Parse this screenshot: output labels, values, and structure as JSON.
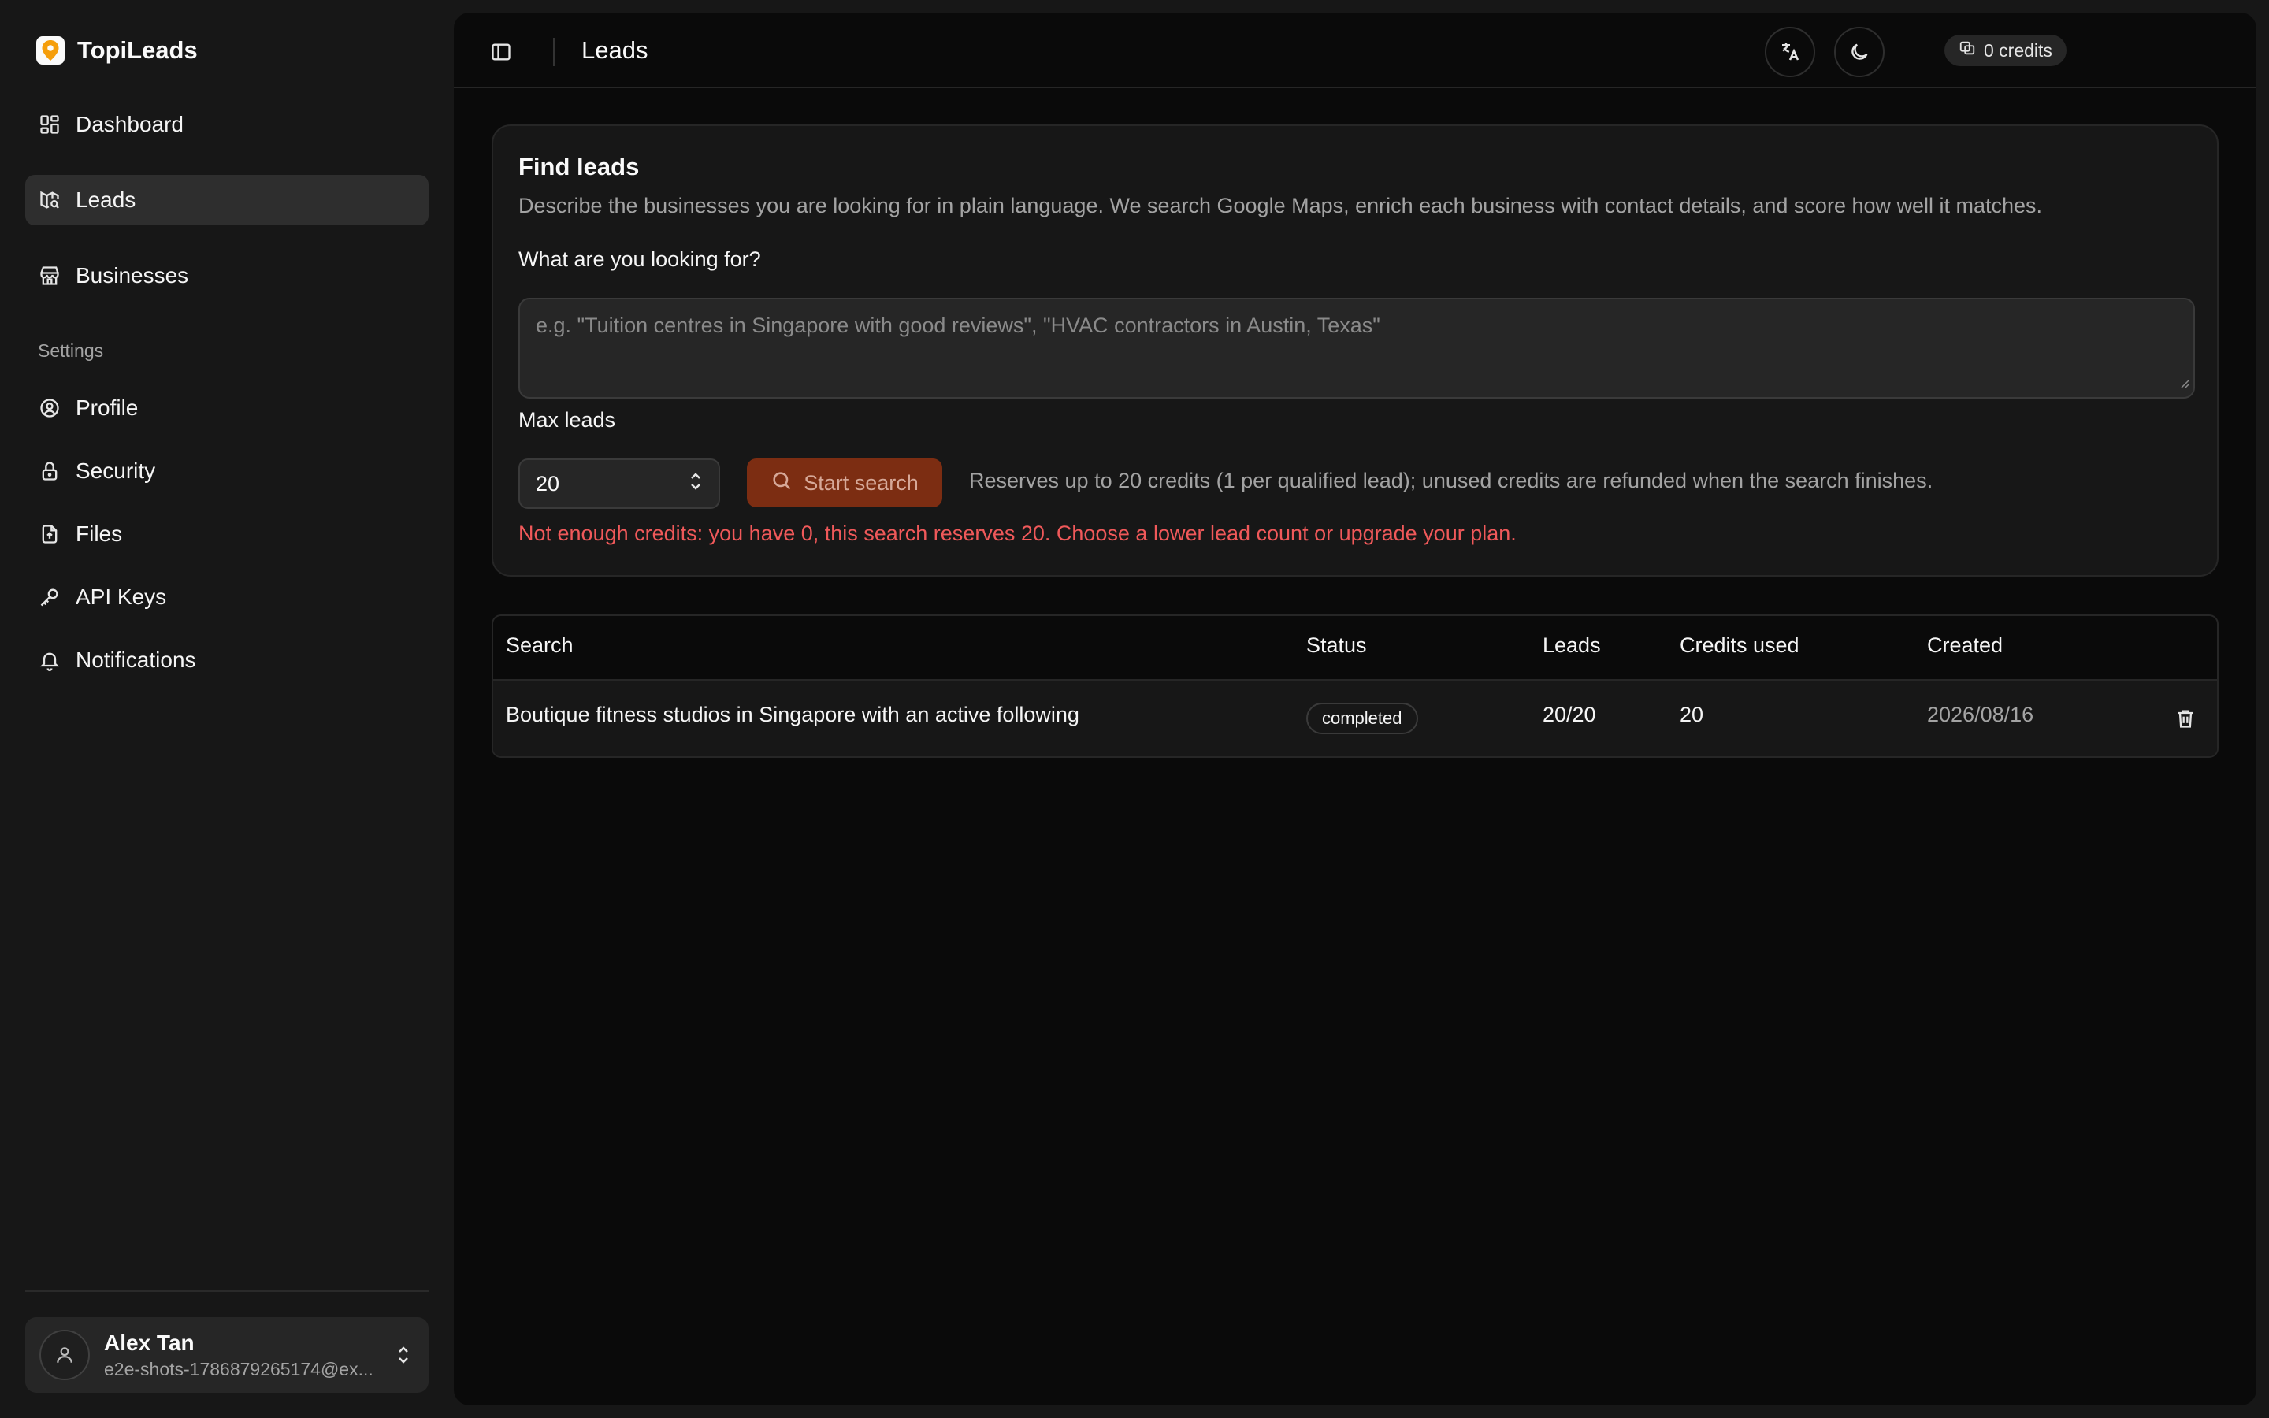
{
  "app": {
    "name": "TopiLeads"
  },
  "sidebar": {
    "items": [
      {
        "label": "Dashboard",
        "icon": "dashboard-icon"
      },
      {
        "label": "Leads",
        "icon": "map-search-icon",
        "active": true
      },
      {
        "label": "Businesses",
        "icon": "store-icon"
      }
    ],
    "settings_label": "Settings",
    "settings_items": [
      {
        "label": "Profile",
        "icon": "user-circle-icon"
      },
      {
        "label": "Security",
        "icon": "lock-icon"
      },
      {
        "label": "Files",
        "icon": "file-upload-icon"
      },
      {
        "label": "API Keys",
        "icon": "key-icon"
      },
      {
        "label": "Notifications",
        "icon": "bell-icon"
      }
    ],
    "user": {
      "name": "Alex Tan",
      "email": "e2e-shots-1786879265174@ex..."
    }
  },
  "header": {
    "title": "Leads",
    "credits": "0 credits"
  },
  "find_leads": {
    "title": "Find leads",
    "description": "Describe the businesses you are looking for in plain language. We search Google Maps, enrich each business with contact details, and score how well it matches.",
    "query_label": "What are you looking for?",
    "query_placeholder": "e.g. \"Tuition centres in Singapore with good reviews\", \"HVAC contractors in Austin, Texas\"",
    "max_label": "Max leads",
    "max_value": "20",
    "start_label": "Start search",
    "reserve_note": "Reserves up to 20 credits (1 per qualified lead); unused credits are refunded when the search finishes.",
    "error": "Not enough credits: you have 0, this search reserves 20. Choose a lower lead count or upgrade your plan."
  },
  "table": {
    "columns": [
      "Search",
      "Status",
      "Leads",
      "Credits used",
      "Created"
    ],
    "rows": [
      {
        "search": "Boutique fitness studios in Singapore with an active following",
        "status": "completed",
        "leads": "20/20",
        "credits_used": "20",
        "created": "2026/08/16"
      }
    ]
  },
  "colors": {
    "accent": "#f59e0b",
    "start_button_bg": "#7c2d12",
    "error": "#f0595a"
  }
}
